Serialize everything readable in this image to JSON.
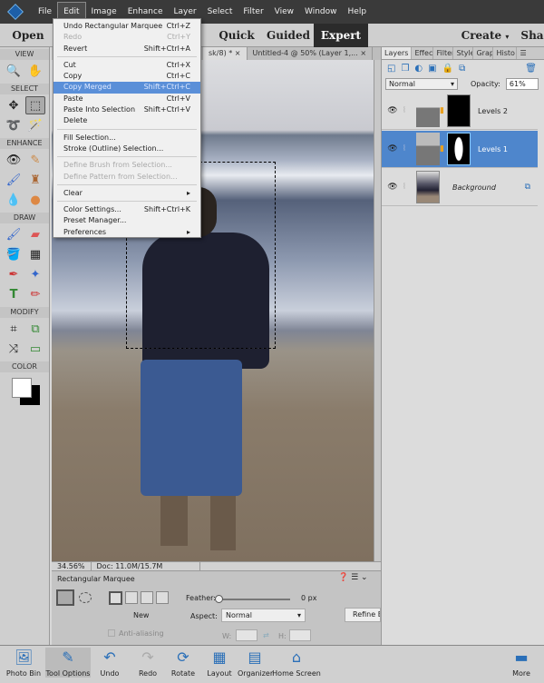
{
  "menubar": {
    "items": [
      "File",
      "Edit",
      "Image",
      "Enhance",
      "Layer",
      "Select",
      "Filter",
      "View",
      "Window",
      "Help"
    ]
  },
  "modebar": {
    "open": "Open",
    "quick": "Quick",
    "guided": "Guided",
    "expert": "Expert",
    "create": "Create",
    "share": "Sha"
  },
  "toolbox": {
    "sections": [
      "VIEW",
      "SELECT",
      "ENHANCE",
      "DRAW",
      "MODIFY",
      "COLOR"
    ]
  },
  "doc_tabs": [
    "sk/8) *",
    "Untitled-4 @ 50% (Layer 1,..."
  ],
  "status": {
    "zoom": "34.56%",
    "doc": "Doc: 11.0M/15.7M"
  },
  "tool_options": {
    "title": "Rectangular Marquee",
    "new_label": "New",
    "anti_aliasing": "Anti-aliasing",
    "feather_label": "Feather:",
    "feather_value": "0 px",
    "feather_fraction": 0,
    "aspect_label": "Aspect:",
    "aspect_value": "Normal",
    "w_label": "W:",
    "h_label": "H:",
    "refine": "Refine E"
  },
  "panel": {
    "tabs": [
      "Layers",
      "Effec",
      "Filter",
      "Style",
      "Grap",
      "Histo"
    ],
    "blend_mode": "Normal",
    "opacity_label": "Opacity:",
    "opacity": "61%",
    "layers": [
      {
        "name": "Levels 2"
      },
      {
        "name": "Levels 1"
      },
      {
        "name": "Background"
      }
    ]
  },
  "edit_menu": [
    {
      "label": "Undo Rectangular Marquee",
      "shortcut": "Ctrl+Z"
    },
    {
      "label": "Redo",
      "shortcut": "Ctrl+Y",
      "disabled": true
    },
    {
      "label": "Revert",
      "shortcut": "Shift+Ctrl+A"
    },
    {
      "label": "Cut",
      "shortcut": "Ctrl+X"
    },
    {
      "label": "Copy",
      "shortcut": "Ctrl+C"
    },
    {
      "label": "Copy Merged",
      "shortcut": "Shift+Ctrl+C",
      "highlighted": true
    },
    {
      "label": "Paste",
      "shortcut": "Ctrl+V"
    },
    {
      "label": "Paste Into Selection",
      "shortcut": "Shift+Ctrl+V"
    },
    {
      "label": "Delete",
      "shortcut": ""
    },
    {
      "label": "Fill Selection...",
      "shortcut": ""
    },
    {
      "label": "Stroke (Outline) Selection...",
      "shortcut": ""
    },
    {
      "label": "Define Brush from Selection...",
      "shortcut": "",
      "disabled": true
    },
    {
      "label": "Define Pattern from Selection...",
      "shortcut": "",
      "disabled": true
    },
    {
      "label": "Clear",
      "shortcut": "▸"
    },
    {
      "label": "Color Settings...",
      "shortcut": "Shift+Ctrl+K"
    },
    {
      "label": "Preset Manager...",
      "shortcut": ""
    },
    {
      "label": "Preferences",
      "shortcut": "▸"
    }
  ],
  "bottombar": [
    "Photo Bin",
    "Tool Options",
    "Undo",
    "Redo",
    "Rotate",
    "Layout",
    "Organizer",
    "Home Screen",
    "More"
  ]
}
